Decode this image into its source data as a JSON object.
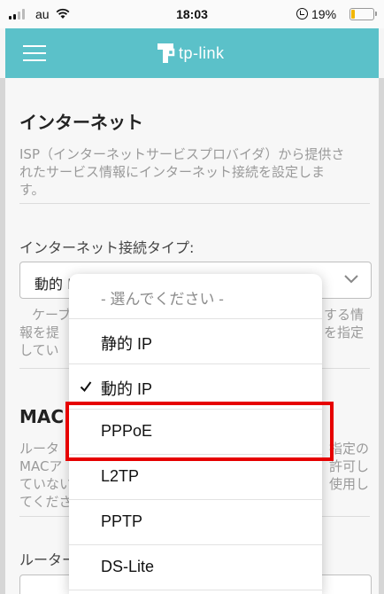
{
  "status_bar": {
    "carrier": "au",
    "time": "18:03",
    "battery_percent": "19%",
    "battery_level": 0.19
  },
  "header": {
    "logo_text": "tp-link",
    "menu_icon": "hamburger-menu-icon",
    "color": "#5bc1c9"
  },
  "internet": {
    "title": "インターネット",
    "description_lines": [
      "ISP（インターネットサービスプロバイダ）から提供さ",
      "れたサービス情報にインターネット接続を設定しま",
      "す。"
    ],
    "connection_type_label": "インターネット接続タイプ:",
    "connection_type_value": "動的 IP",
    "hint_fragments_left": [
      "ケーブ",
      "報を提",
      "してい"
    ],
    "hint_fragments_right": [
      "する情",
      "を指定"
    ]
  },
  "mac": {
    "title": "MAC",
    "fragments_left": [
      "ルータ",
      "MACア",
      "ていない",
      "てくださ"
    ],
    "fragments_right": [
      "指定の",
      "許可し",
      "使用し"
    ]
  },
  "router_label_fragment": "ルーター",
  "dropdown": {
    "options": [
      {
        "label": "- 選んでください -",
        "placeholder": true,
        "selected": false
      },
      {
        "label": "静的 IP",
        "placeholder": false,
        "selected": false
      },
      {
        "label": "動的 IP",
        "placeholder": false,
        "selected": true
      },
      {
        "label": "PPPoE",
        "placeholder": false,
        "selected": false,
        "highlighted": true
      },
      {
        "label": "L2TP",
        "placeholder": false,
        "selected": false
      },
      {
        "label": "PPTP",
        "placeholder": false,
        "selected": false
      },
      {
        "label": "DS-Lite",
        "placeholder": false,
        "selected": false
      }
    ]
  },
  "colors": {
    "accent": "#5bc1c9",
    "highlight": "#e60000",
    "battery": "#f2b600"
  }
}
